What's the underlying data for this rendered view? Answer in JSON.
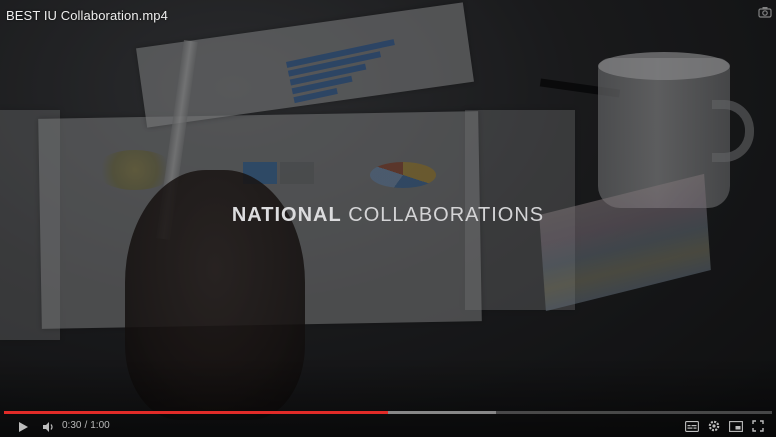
{
  "video": {
    "title": "BEST IU Collaboration.mp4"
  },
  "overlay": {
    "headline_strong": "NATIONAL",
    "headline_light": "COLLABORATIONS"
  },
  "player": {
    "current_time": "0:30",
    "separator": "/",
    "duration": "1:00",
    "progress_played": 0.5,
    "progress_buffered": 0.64,
    "accent_color": "#e12b28",
    "controls": {
      "play": "play-icon",
      "volume": "volume-icon",
      "subtitles": "subtitles-icon",
      "settings": "gear-icon",
      "miniplayer": "miniplayer-icon",
      "fullscreen": "fullscreen-icon"
    }
  }
}
